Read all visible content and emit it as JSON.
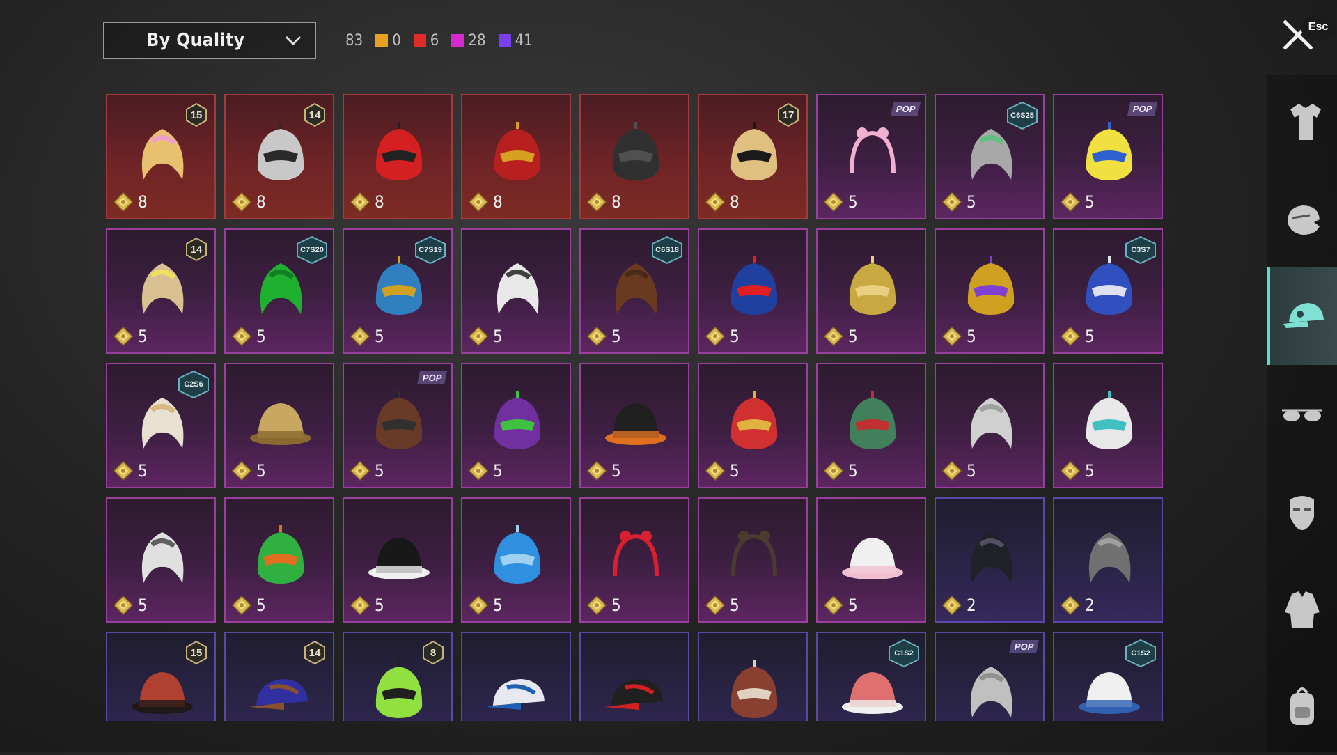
{
  "toolbar": {
    "sort_label": "By Quality",
    "total": "83",
    "quality_counts": [
      {
        "color": "#e6a11e",
        "count": "0"
      },
      {
        "color": "#e02b2b",
        "count": "6"
      },
      {
        "color": "#d42ad0",
        "count": "28"
      },
      {
        "color": "#7b3ff2",
        "count": "41"
      }
    ]
  },
  "close": {
    "esc_label": "Esc"
  },
  "items": [
    {
      "tier": "red",
      "price": "8",
      "badge_type": "number",
      "badge": "15",
      "icon": "blonde-maid-hair-icon",
      "c1": "#e8c070",
      "c2": "#f0a0c8"
    },
    {
      "tier": "red",
      "price": "8",
      "badge_type": "number",
      "badge": "14",
      "icon": "cat-ear-helmet-icon",
      "c1": "#c8c8c8",
      "c2": "#2a2a2a"
    },
    {
      "tier": "red",
      "price": "8",
      "badge_type": "none",
      "badge": "",
      "icon": "red-helmet-icon",
      "c1": "#d42020",
      "c2": "#222222"
    },
    {
      "tier": "red",
      "price": "8",
      "badge_type": "none",
      "badge": "",
      "icon": "red-gold-helmet-icon",
      "c1": "#b82020",
      "c2": "#d8a020"
    },
    {
      "tier": "red",
      "price": "8",
      "badge_type": "none",
      "badge": "",
      "icon": "black-knight-helmet-icon",
      "c1": "#303030",
      "c2": "#505050"
    },
    {
      "tier": "red",
      "price": "8",
      "badge_type": "number",
      "badge": "17",
      "icon": "gold-mask-helmet-icon",
      "c1": "#e0c080",
      "c2": "#1a1a1a"
    },
    {
      "tier": "magenta",
      "price": "5",
      "badge_type": "pop",
      "badge": "POP",
      "icon": "pink-bow-headband-icon",
      "c1": "#f0b0d0",
      "c2": "#f0b0d0"
    },
    {
      "tier": "magenta",
      "price": "5",
      "badge_type": "season",
      "badge": "C6S25",
      "icon": "grey-hair-bun-icon",
      "c1": "#a8a8a8",
      "c2": "#60c080"
    },
    {
      "tier": "magenta",
      "price": "5",
      "badge_type": "pop",
      "badge": "POP",
      "icon": "yellow-box-head-icon",
      "c1": "#f0e040",
      "c2": "#3060d0"
    },
    {
      "tier": "magenta",
      "price": "5",
      "badge_type": "number",
      "badge": "14",
      "icon": "blonde-flower-hair-icon",
      "c1": "#d8c090",
      "c2": "#f0e060"
    },
    {
      "tier": "magenta",
      "price": "5",
      "badge_type": "season",
      "badge": "C7S20",
      "icon": "green-hair-icon",
      "c1": "#20b030",
      "c2": "#108020"
    },
    {
      "tier": "magenta",
      "price": "5",
      "badge_type": "season",
      "badge": "C7S19",
      "icon": "blue-dreadlock-helmet-icon",
      "c1": "#3080c0",
      "c2": "#d0a020"
    },
    {
      "tier": "magenta",
      "price": "5",
      "badge_type": "none",
      "badge": "",
      "icon": "white-long-hair-icon",
      "c1": "#e8e8e8",
      "c2": "#404040"
    },
    {
      "tier": "magenta",
      "price": "5",
      "badge_type": "season",
      "badge": "C6S18",
      "icon": "brown-hair-icon",
      "c1": "#6a3a20",
      "c2": "#4a2a18"
    },
    {
      "tier": "magenta",
      "price": "5",
      "badge_type": "none",
      "badge": "",
      "icon": "blue-demon-helmet-icon",
      "c1": "#2040a0",
      "c2": "#e02020"
    },
    {
      "tier": "magenta",
      "price": "5",
      "badge_type": "none",
      "badge": "",
      "icon": "gold-dragon-helmet-icon",
      "c1": "#c8a840",
      "c2": "#e8d080"
    },
    {
      "tier": "magenta",
      "price": "5",
      "badge_type": "none",
      "badge": "",
      "icon": "gold-purple-mask-icon",
      "c1": "#d0a020",
      "c2": "#8040d0"
    },
    {
      "tier": "magenta",
      "price": "5",
      "badge_type": "season",
      "badge": "C3S7",
      "icon": "blue-fairy-headpiece-icon",
      "c1": "#3050c0",
      "c2": "#e0e0f0"
    },
    {
      "tier": "magenta",
      "price": "5",
      "badge_type": "season",
      "badge": "C2S6",
      "icon": "white-hood-blonde-hair-icon",
      "c1": "#e8e0d0",
      "c2": "#d8b880"
    },
    {
      "tier": "magenta",
      "price": "5",
      "badge_type": "none",
      "badge": "",
      "icon": "straw-hat-icon",
      "c1": "#c8a860",
      "c2": "#8a6a30"
    },
    {
      "tier": "magenta",
      "price": "5",
      "badge_type": "pop",
      "badge": "POP",
      "icon": "gas-mask-helmet-icon",
      "c1": "#6a3a28",
      "c2": "#303030"
    },
    {
      "tier": "magenta",
      "price": "5",
      "badge_type": "none",
      "badge": "",
      "icon": "purple-green-mech-helmet-icon",
      "c1": "#7030a0",
      "c2": "#40c040"
    },
    {
      "tier": "magenta",
      "price": "5",
      "badge_type": "none",
      "badge": "",
      "icon": "black-top-hat-icon",
      "c1": "#202020",
      "c2": "#e07020"
    },
    {
      "tier": "magenta",
      "price": "5",
      "badge_type": "none",
      "badge": "",
      "icon": "red-warrior-helmet-icon",
      "c1": "#d03030",
      "c2": "#e0b040"
    },
    {
      "tier": "magenta",
      "price": "5",
      "badge_type": "none",
      "badge": "",
      "icon": "green-helmet-icon",
      "c1": "#40805a",
      "c2": "#c03030"
    },
    {
      "tier": "magenta",
      "price": "5",
      "badge_type": "none",
      "badge": "",
      "icon": "silver-hair-icon",
      "c1": "#d0d0d0",
      "c2": "#a0a0a0"
    },
    {
      "tier": "magenta",
      "price": "5",
      "badge_type": "none",
      "badge": "",
      "icon": "white-cyber-mask-icon",
      "c1": "#e8e8e8",
      "c2": "#40c0c0"
    },
    {
      "tier": "magenta",
      "price": "5",
      "badge_type": "none",
      "badge": "",
      "icon": "lion-mane-icon",
      "c1": "#e0e0e0",
      "c2": "#606060"
    },
    {
      "tier": "magenta",
      "price": "5",
      "badge_type": "none",
      "badge": "",
      "icon": "frog-goggles-helmet-icon",
      "c1": "#30b040",
      "c2": "#e07020"
    },
    {
      "tier": "magenta",
      "price": "5",
      "badge_type": "none",
      "badge": "",
      "icon": "black-beanie-icon",
      "c1": "#181818",
      "c2": "#f0f0f0"
    },
    {
      "tier": "magenta",
      "price": "5",
      "badge_type": "none",
      "badge": "",
      "icon": "blue-spiky-mask-icon",
      "c1": "#3090e0",
      "c2": "#a0d0f0"
    },
    {
      "tier": "magenta",
      "price": "5",
      "badge_type": "none",
      "badge": "",
      "icon": "heart-headband-icon",
      "c1": "#d82030",
      "c2": "#d82030"
    },
    {
      "tier": "magenta",
      "price": "5",
      "badge_type": "none",
      "badge": "",
      "icon": "horn-headband-icon",
      "c1": "#4a3a30",
      "c2": "#4a3a30"
    },
    {
      "tier": "magenta",
      "price": "5",
      "badge_type": "none",
      "badge": "",
      "icon": "white-bucket-hat-icon",
      "c1": "#f0f0f0",
      "c2": "#f0c0d0"
    },
    {
      "tier": "purple",
      "price": "2",
      "badge_type": "none",
      "badge": "",
      "icon": "black-hair-clip-icon",
      "c1": "#202028",
      "c2": "#505060"
    },
    {
      "tier": "purple",
      "price": "2",
      "badge_type": "none",
      "badge": "",
      "icon": "grey-hair-clip-icon",
      "c1": "#707070",
      "c2": "#a0a0a0"
    },
    {
      "tier": "purple",
      "price": "",
      "badge_type": "number",
      "badge": "15",
      "icon": "pumpkin-hat-hair-icon",
      "c1": "#b04030",
      "c2": "#201818"
    },
    {
      "tier": "purple",
      "price": "",
      "badge_type": "number",
      "badge": "14",
      "icon": "cat-cap-brown-hair-icon",
      "c1": "#3030a0",
      "c2": "#8a5030"
    },
    {
      "tier": "purple",
      "price": "",
      "badge_type": "number",
      "badge": "8",
      "icon": "green-skull-hood-icon",
      "c1": "#90e040",
      "c2": "#202020"
    },
    {
      "tier": "purple",
      "price": "",
      "badge_type": "none",
      "badge": "",
      "icon": "white-blue-cap-icon",
      "c1": "#e8e8f0",
      "c2": "#2060b0"
    },
    {
      "tier": "purple",
      "price": "",
      "badge_type": "none",
      "badge": "",
      "icon": "black-red-cap-icon",
      "c1": "#202020",
      "c2": "#d02020"
    },
    {
      "tier": "purple",
      "price": "",
      "badge_type": "none",
      "badge": "",
      "icon": "brown-head-wrap-icon",
      "c1": "#8a4030",
      "c2": "#e0d0c0"
    },
    {
      "tier": "purple",
      "price": "",
      "badge_type": "season",
      "badge": "C1S2",
      "icon": "pink-camo-beanie-icon",
      "c1": "#e07070",
      "c2": "#f0f0f0"
    },
    {
      "tier": "purple",
      "price": "",
      "badge_type": "pop",
      "badge": "POP",
      "icon": "silver-bob-hair-icon",
      "c1": "#c0c0c0",
      "c2": "#909090"
    },
    {
      "tier": "purple",
      "price": "",
      "badge_type": "season",
      "badge": "C1S2",
      "icon": "chef-hat-mask-icon",
      "c1": "#f0f0f0",
      "c2": "#3060b0"
    }
  ],
  "sidebar": [
    {
      "name": "outfit",
      "icon": "outfit-icon",
      "active": false
    },
    {
      "name": "face",
      "icon": "face-icon",
      "active": false
    },
    {
      "name": "headwear",
      "icon": "cap-icon",
      "active": true
    },
    {
      "name": "eyewear",
      "icon": "glasses-icon",
      "active": false
    },
    {
      "name": "mask",
      "icon": "mask-icon",
      "active": false
    },
    {
      "name": "jacket",
      "icon": "jacket-icon",
      "active": false
    },
    {
      "name": "bag",
      "icon": "backpack-icon",
      "active": false
    }
  ]
}
